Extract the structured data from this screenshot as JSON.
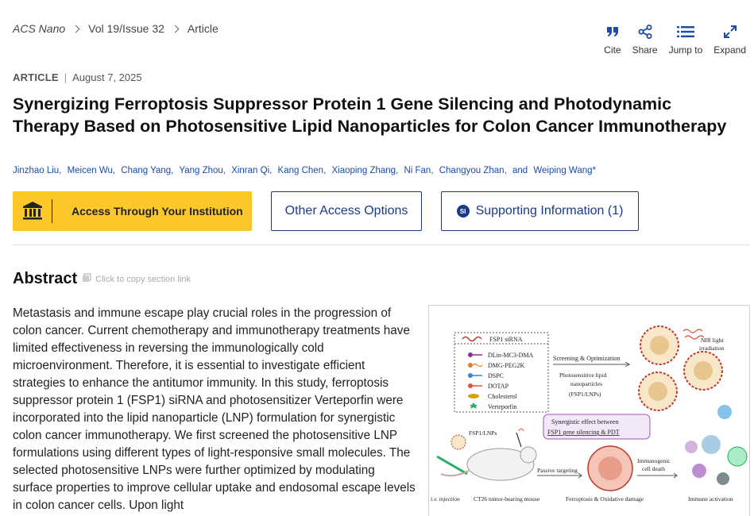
{
  "breadcrumb": {
    "journal": "ACS Nano",
    "issue": "Vol 19/Issue 32",
    "section": "Article"
  },
  "toolbar": {
    "cite": {
      "label": "Cite",
      "icon": "quote-icon"
    },
    "share": {
      "label": "Share",
      "icon": "share-icon"
    },
    "jump": {
      "label": "Jump to",
      "icon": "list-icon"
    },
    "expand": {
      "label": "Expand",
      "icon": "expand-icon"
    }
  },
  "article": {
    "type": "ARTICLE",
    "date": "August 7, 2025",
    "title": "Synergizing Ferroptosis Suppressor Protein 1 Gene Silencing and Photodynamic Therapy Based on Photosensitive Lipid Nanoparticles for Colon Cancer Immunotherapy",
    "authors": [
      "Jinzhao Liu,",
      "Meicen Wu,",
      "Chang Yang,",
      "Yang Zhou,",
      "Xinran Qi,",
      "Kang Chen,",
      "Xiaoping Zhang,",
      "Ni Fan,",
      "Changyou Zhan,"
    ],
    "authors_and": "and",
    "last_author": "Weiping Wang*"
  },
  "access": {
    "institution_label": "Access Through Your Institution",
    "other_label": "Other Access Options",
    "si_badge": "SI",
    "si_label": "Supporting Information (1)"
  },
  "abstract": {
    "heading": "Abstract",
    "copy_link": "Click to copy section link",
    "text": "Metastasis and immune escape play crucial roles in the progression of colon cancer. Current chemotherapy and immunotherapy treatments have limited effectiveness in reversing the immunologically cold microenvironment. Therefore, it is essential to investigate efficient strategies to enhance the antitumor immunity. In this study, ferroptosis suppressor protein 1 (FSP1) siRNA and photosensitizer Verteporfin were incorporated into the lipid nanoparticle (LNP) formulation for synergistic colon cancer immunotherapy. We first screened the photosensitive LNP formulations using different types of light-responsive small molecules. The selected photosensitive LNPs were further optimized by modulating surface properties to improve cellular uptake and endosomal escape levels in colon cancer cells. Upon light"
  },
  "figure": {
    "legend": [
      "FSP1 siRNA",
      "DLin-MC3-DMA",
      "DMG-PEG2K",
      "DSPC",
      "DOTAP",
      "Cholesterol",
      "Verteporfin"
    ],
    "screening": "Screening & Optimization",
    "lnp_desc_1": "Photosensitive lipid",
    "lnp_desc_2": "nanoparticles",
    "lnp_desc_3": "(FSP1/LNPs)",
    "nir_1": "NIR light",
    "nir_2": "irradiation",
    "synergy_1": "Synergistic effect between",
    "synergy_2": "FSP1 gene silencing & PDT",
    "fsp1_lnps": "FSP1/LNPs",
    "passive": "Passive targeting",
    "immunogenic_1": "Immunogenic",
    "immunogenic_2": "cell death",
    "iv": "i.v. injection",
    "mouse": "CT26 tumor-bearing mouse",
    "ferro": "Ferroptosis & Oxidative damage",
    "immune": "Immune activation"
  },
  "colors": {
    "link": "#1a4bab",
    "accent_yellow": "#fcc72b",
    "button_border": "#1a3a7a"
  }
}
